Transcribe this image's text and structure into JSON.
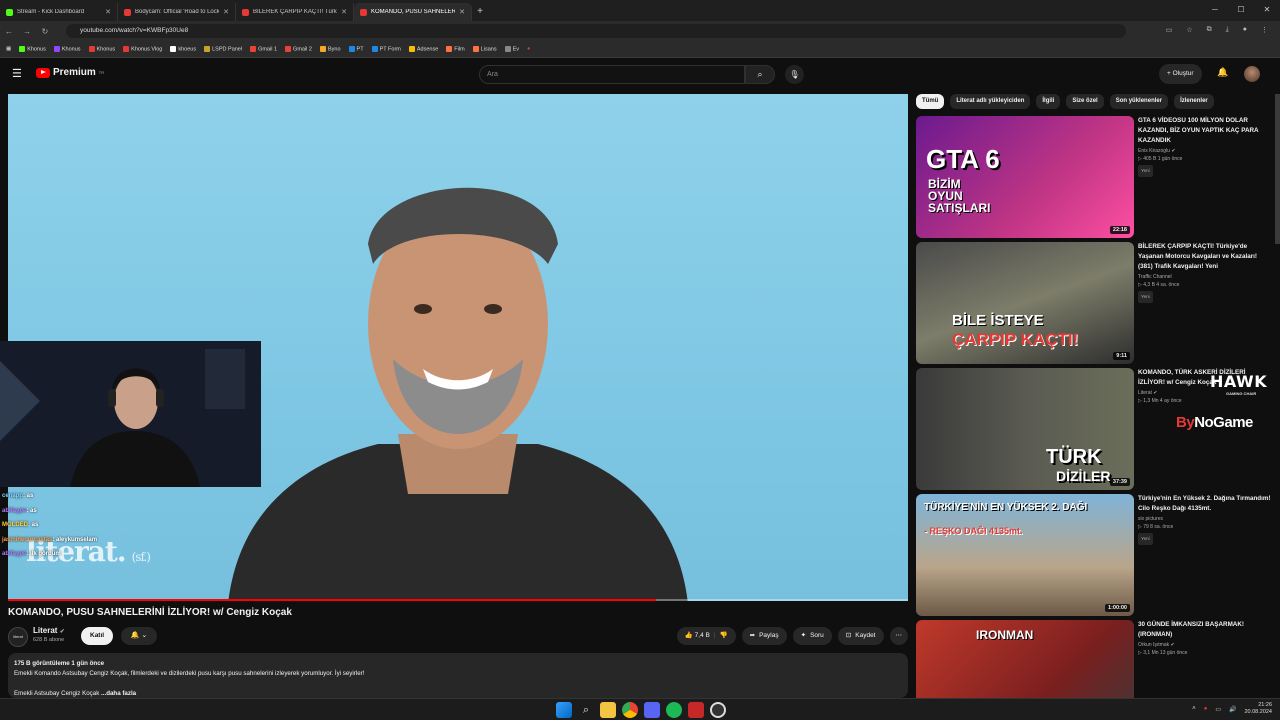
{
  "browser": {
    "tabs": [
      {
        "title": "Stream - Kick Dashboard",
        "active": false
      },
      {
        "title": "Bodycam: Official 'Road to Lock",
        "active": false
      },
      {
        "title": "BİLEREK ÇARPIP KAÇTI! Türkiye",
        "active": false
      },
      {
        "title": "KOMANDO, PUSU SAHNELERİNİ",
        "active": true
      }
    ],
    "url": "youtube.com/watch?v=KWBFp30Ue8",
    "bookmarks": [
      "Khonus",
      "Khonus",
      "Khonus",
      "Khonus Vlog",
      "khoeus",
      "LSPD Panel",
      "Gmail 1",
      "Gmail 2",
      "Byno",
      "PT",
      "PT Form",
      "Adsense",
      "Film",
      "Lisans",
      "Ev"
    ]
  },
  "youtube": {
    "logo": "Premium",
    "logo_sup": "TR",
    "search_placeholder": "Ara",
    "create_label": "+ Oluştur",
    "video": {
      "title": "KOMANDO, PUSU SAHNELERİNİ İZLİYOR! w/ Cengiz Koçak",
      "channel": "Literat",
      "subscribers": "628 B abone",
      "join_label": "Katıl",
      "likes": "7,4 B",
      "share_label": "Paylaş",
      "ask_label": "Soru",
      "save_label": "Kaydet",
      "progress": 0.72,
      "description_meta": "175 B görüntüleme  1 gün önce",
      "description_line1": "Emekli Komando Astsubay Cengiz Koçak, filmlerdeki ve dizilerdeki pusu karşı pusu sahnelerini izleyerek yorumluyor. İyi seyirler!",
      "description_line2": "Emekli Astsubay Cengiz Koçak",
      "more_label": "...daha fazla",
      "watermark": "literat.",
      "watermark_small": "(sf.)",
      "channel_avatar_text": "literat"
    },
    "chat": [
      {
        "user": "cenapp",
        "msg": ": as",
        "color": "#7fd3ff"
      },
      {
        "user": "abifaype",
        "msg": ": as",
        "color": "#b07cff"
      },
      {
        "user": "MOLDED",
        "msg": ": as",
        "color": "#ffcf33"
      },
      {
        "user": "jasminecurcastas",
        "msg": ": aleykumselam",
        "color": "#ff9f43"
      },
      {
        "user": "abifaype",
        "msg": ": ilk gördüm",
        "color": "#b07cff"
      }
    ],
    "chips": [
      "Tümü",
      "Literat adlı yükleyiciden",
      "İlgili",
      "Size özel",
      "Son yüklenenler",
      "İzlenenler"
    ],
    "recommendations": [
      {
        "title": "GTA 6 VİDEOSU 100 MİLYON DOLAR KAZANDI, BİZ OYUN YAPTIK KAÇ PARA KAZANDIK",
        "channel": "Enis Kirazoglu ✔",
        "meta": "▷ 405 B  1 gün önce",
        "badge": "Yeni",
        "duration": "22:18",
        "thumb_text": "GTA 6",
        "thumb_sub": "BİZİM OYUN SATIŞLARI"
      },
      {
        "title": "BİLEREK ÇARPIP KAÇTI! Türkiye'de Yaşanan Motorcu Kavgaları ve Kazaları! (381) Trafik Kavgaları! Yeni",
        "channel": "Traffic Channel",
        "meta": "▷ 4,3 B  4 sa. önce",
        "badge": "Yeni",
        "duration": "9:11",
        "thumb_text": "BİLE İSTEYE",
        "thumb_sub": "ÇARPIP KAÇTI!"
      },
      {
        "title": "KOMANDO, TÜRK ASKERİ DİZİLERİ İZLİYOR! w/ Cengiz Koçak",
        "channel": "Literat ✔",
        "meta": "▷ 1,3 Mn  4 ay önce",
        "badge": "",
        "duration": "37:39",
        "thumb_text": "TÜRK",
        "thumb_sub": "DİZİLER"
      },
      {
        "title": "Türkiye'nin En Yüksek 2. Dağına Tırmandım! Cilo Reşko Dağı 4135mt.",
        "channel": "six pictures",
        "meta": "▷ 79  8 sa. önce",
        "badge": "Yeni",
        "duration": "1:00:00",
        "thumb_text": "TÜRKİYE'NİN EN YÜKSEK 2. DAĞI",
        "thumb_sub": "- REŞKO DAĞI 4135mt."
      },
      {
        "title": "30 GÜNDE İMKANSIZI BAŞARMAK! (IRONMAN)",
        "channel": "Orkun Işıtmak ✔",
        "meta": "▷ 3,1 Mn  13 gün önce",
        "badge": "",
        "duration": "",
        "thumb_text": "IRONMAN",
        "thumb_sub": ""
      }
    ],
    "overlay": {
      "hawk": "HAWK",
      "hawk_sub": "GAMING CHAIR",
      "bynogame_a": "By",
      "bynogame_b": "NoGame"
    }
  },
  "taskbar": {
    "time": "21:26",
    "date": "20.08.2024"
  }
}
